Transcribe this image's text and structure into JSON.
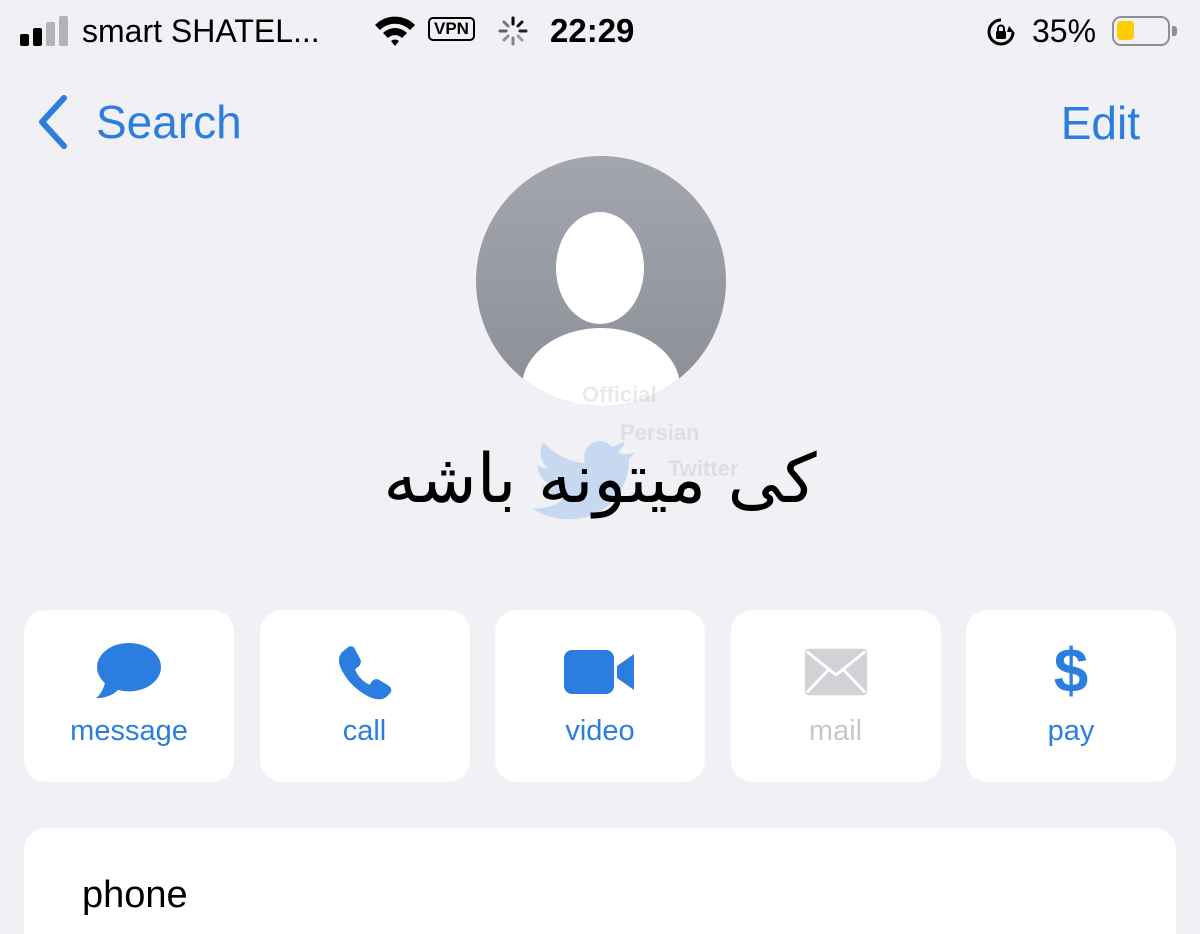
{
  "status_bar": {
    "carrier": "smart SHATEL...",
    "vpn": "VPN",
    "time": "22:29",
    "battery_percent": "35%",
    "battery_level": 0.35
  },
  "nav": {
    "back_label": "Search",
    "edit_label": "Edit"
  },
  "contact": {
    "name": "کی میتونه باشه"
  },
  "watermark": {
    "line1": "Official",
    "line2": "Persian",
    "line3": "Twitter"
  },
  "actions": [
    {
      "label": "message",
      "icon": "message-bubble-icon",
      "enabled": true
    },
    {
      "label": "call",
      "icon": "phone-icon",
      "enabled": true
    },
    {
      "label": "video",
      "icon": "video-camera-icon",
      "enabled": true
    },
    {
      "label": "mail",
      "icon": "envelope-icon",
      "enabled": false
    },
    {
      "label": "pay",
      "icon": "dollar-icon",
      "enabled": true
    }
  ],
  "phone_section": {
    "label": "phone"
  },
  "colors": {
    "accent": "#2b7ee0",
    "background": "#f0f0f5",
    "disabled": "#c7c7cc",
    "battery": "#ffcc00"
  }
}
